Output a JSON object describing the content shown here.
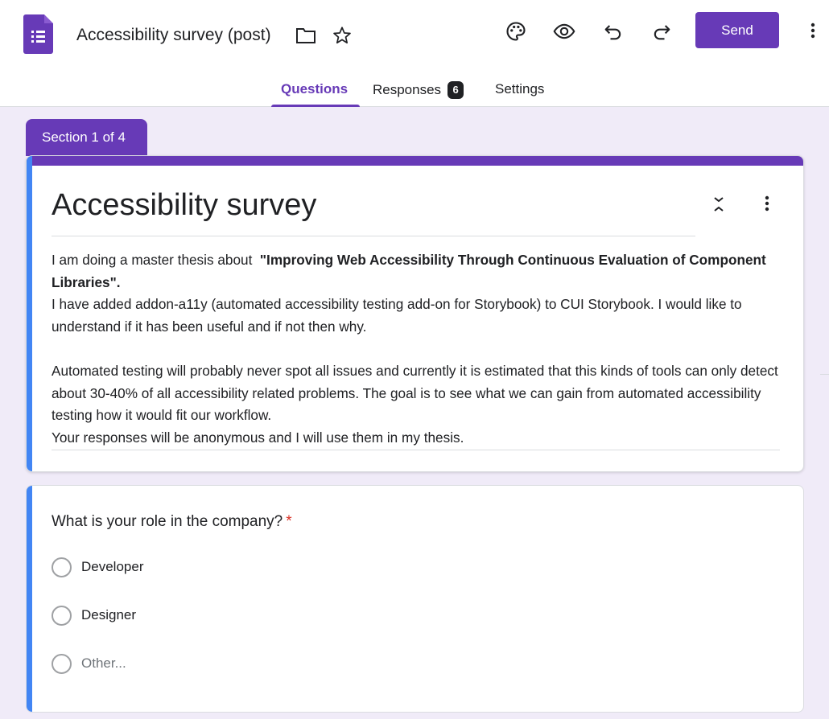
{
  "app": {
    "doc_title": "Accessibility survey (post)",
    "send_label": "Send",
    "brand_color": "#673ab7",
    "icons": [
      "forms-app-icon",
      "folder-icon",
      "star-icon",
      "palette-icon",
      "preview-eye-icon",
      "undo-icon",
      "redo-icon",
      "more-vert-icon"
    ]
  },
  "tabs": [
    {
      "label": "Questions",
      "active": true
    },
    {
      "label": "Responses",
      "badge": "6",
      "active": false
    },
    {
      "label": "Settings",
      "active": false
    }
  ],
  "section": {
    "label": "Section 1 of 4"
  },
  "form_header": {
    "title": "Accessibility survey",
    "desc_line1_prefix": "I am doing a master thesis about  ",
    "desc_line1_bold": "\"Improving Web Accessibility Through Continuous Evaluation of Component Libraries\".",
    "desc_line2": "I have added addon-a11y (automated accessibility testing add-on for Storybook) to CUI Storybook. I would like to understand if it has been useful and if not then why.",
    "desc_line3": "Automated testing will probably never spot all issues and currently it is estimated that this kinds of tools can only detect about 30-40% of all accessibility related problems. The goal is to see what we can gain from automated accessibility testing how it would fit our workflow.",
    "desc_line4": "Your responses will be anonymous and I will use them in my thesis."
  },
  "question": {
    "title": "What is your role in the company?",
    "required_mark": "*",
    "options": [
      {
        "label": "Developer"
      },
      {
        "label": "Designer"
      },
      {
        "label": "Other..."
      }
    ]
  }
}
